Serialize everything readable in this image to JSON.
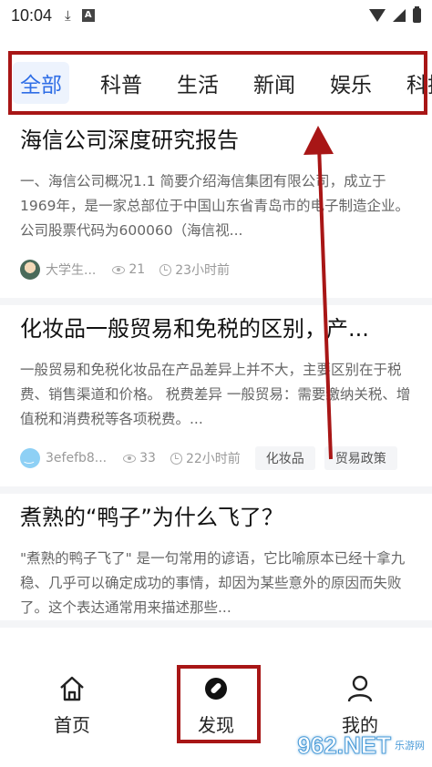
{
  "status_bar": {
    "time": "10:04",
    "icons": [
      "download-icon",
      "a-box-icon",
      "wifi-icon",
      "signal-icon",
      "battery-icon"
    ],
    "a_icon_label": "A"
  },
  "tabs": [
    {
      "label": "全部",
      "active": true
    },
    {
      "label": "科普",
      "active": false
    },
    {
      "label": "生活",
      "active": false
    },
    {
      "label": "新闻",
      "active": false
    },
    {
      "label": "娱乐",
      "active": false
    },
    {
      "label": "科技",
      "active": false
    }
  ],
  "articles": [
    {
      "title": "海信公司深度研究报告",
      "summary": "一、海信公司概况1.1 简要介绍海信集团有限公司，成立于1969年，是一家总部位于中国山东省青岛市的电子制造企业。公司股票代码为600060（海信视...",
      "author": "大学生...",
      "views": "21",
      "time": "23小时前",
      "tags": []
    },
    {
      "title": "化妆品一般贸易和免税的区别，产...",
      "summary": "一般贸易和免税化妆品在产品差异上并不大，主要区别在于税费、销售渠道和价格。 税费差异 一般贸易：需要缴纳关税、增值税和消费税等各项税费。...",
      "author": "3efefb8...",
      "views": "33",
      "time": "22小时前",
      "tags": [
        "化妆品",
        "贸易政策"
      ]
    },
    {
      "title": "煮熟的“鸭子”为什么飞了？",
      "summary": "\"煮熟的鸭子飞了\" 是一句常用的谚语，它比喻原本已经十拿九稳、几乎可以确定成功的事情，却因为某些意外的原因而失败了。这个表达通常用来描述那些...",
      "author": "",
      "views": "",
      "time": "",
      "tags": []
    }
  ],
  "bottom_nav": [
    {
      "label": "首页",
      "icon": "home-icon"
    },
    {
      "label": "发现",
      "icon": "compass-icon"
    },
    {
      "label": "我的",
      "icon": "user-icon"
    }
  ],
  "watermark": {
    "logo": "962.NET",
    "sub": "乐游网"
  },
  "colors": {
    "accent": "#2f6ee6",
    "annotation": "#a81616"
  }
}
